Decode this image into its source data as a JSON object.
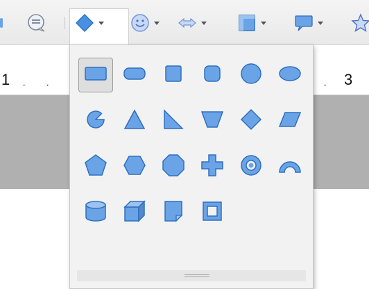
{
  "ruler": {
    "left_number": "1",
    "right_number": "3",
    "dot": "·"
  },
  "colors": {
    "shape_fill": "#6aa4e6",
    "shape_stroke": "#2e6fc0",
    "selected_bg": "#dedede"
  },
  "toolbar": {
    "buttons": [
      {
        "icon": "comment-icon"
      },
      {
        "icon": "basic-shapes-icon",
        "active": true
      },
      {
        "icon": "smiley-icon"
      },
      {
        "icon": "double-arrow-icon"
      },
      {
        "icon": "flowchart-icon"
      },
      {
        "icon": "callout-icon"
      },
      {
        "icon": "star-icon"
      }
    ]
  },
  "shapes_dropdown": {
    "rows": [
      [
        "rectangle",
        "rounded-rectangle",
        "square",
        "rounded-square",
        "circle",
        "ellipse"
      ],
      [
        "circle-pie",
        "isosceles-triangle",
        "right-triangle",
        "trapezoid",
        "diamond",
        "parallelogram"
      ],
      [
        "pentagon",
        "hexagon",
        "octagon",
        "cross",
        "ring",
        "block-arc"
      ],
      [
        "cylinder",
        "cube",
        "folded-corner",
        "frame"
      ]
    ],
    "selected": "rectangle"
  }
}
